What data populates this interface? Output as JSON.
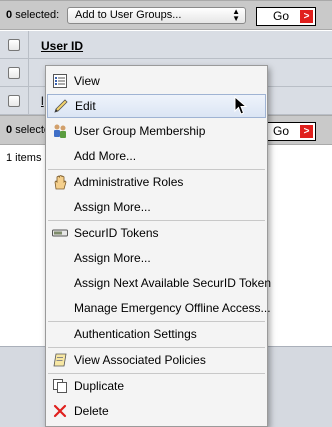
{
  "top_bar": {
    "selected_count": "0",
    "selected_label": "selected:",
    "action_select_value": "Add to User Groups...",
    "go_label": "Go"
  },
  "table": {
    "header": "User ID",
    "row_link_prefix": "l"
  },
  "bottom_bar": {
    "selected_count": "0",
    "selected_label": "selecte",
    "go_label": "Go"
  },
  "items_text": "1 items",
  "menu": {
    "items": [
      {
        "label": "View",
        "icon": "view-icon"
      },
      {
        "label": "Edit",
        "icon": "pencil-icon"
      },
      {
        "label": "User Group Membership",
        "icon": "user-group-icon"
      },
      {
        "label": "Add More...",
        "icon": ""
      },
      {
        "label": "Administrative Roles",
        "icon": "hand-icon"
      },
      {
        "label": "Assign More...",
        "icon": ""
      },
      {
        "label": "SecurID Tokens",
        "icon": "token-icon"
      },
      {
        "label": "Assign More...",
        "icon": ""
      },
      {
        "label": "Assign Next Available SecurID Token",
        "icon": ""
      },
      {
        "label": "Manage Emergency Offline Access...",
        "icon": ""
      },
      {
        "label": "Authentication Settings",
        "icon": ""
      },
      {
        "label": "View Associated Policies",
        "icon": "policy-icon"
      },
      {
        "label": "Duplicate",
        "icon": "duplicate-icon"
      },
      {
        "label": "Delete",
        "icon": "delete-x-icon"
      }
    ]
  },
  "colors": {
    "highlight": "#dbe5f4",
    "go_arrow": "#e0201d",
    "delete_x": "#e0201d",
    "table_bg": "#d9dde4"
  }
}
